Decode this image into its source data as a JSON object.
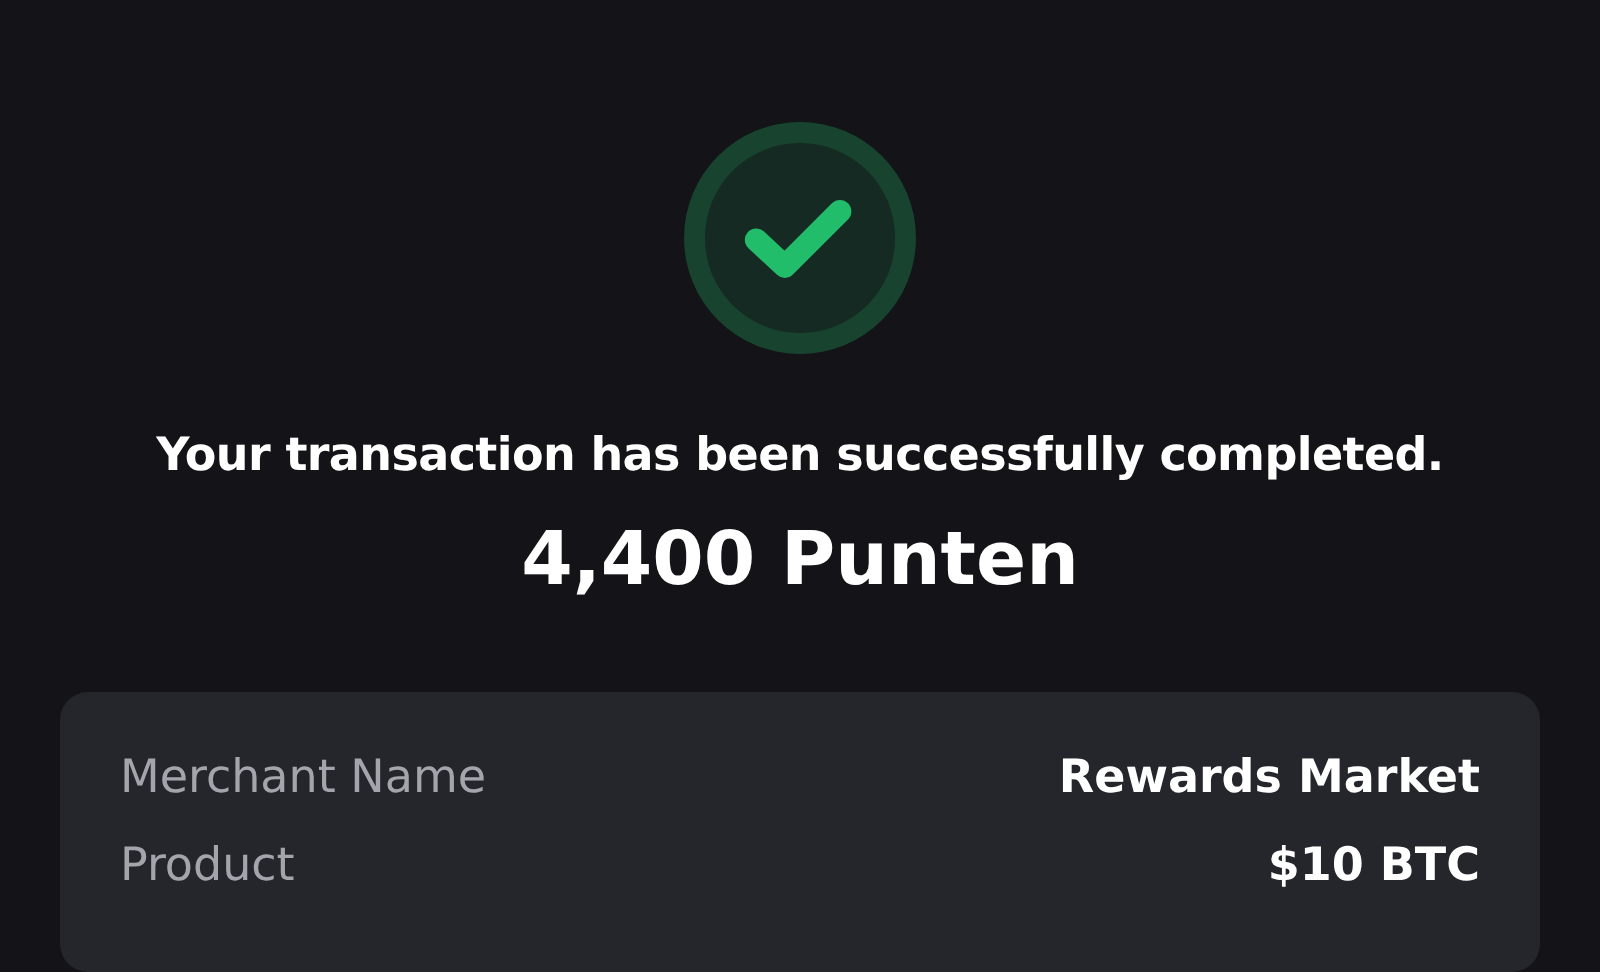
{
  "message": "Your transaction has been successfully completed.",
  "amount": "4,400 Punten",
  "details": [
    {
      "label": "Merchant Name",
      "value": "Rewards Market"
    },
    {
      "label": "Product",
      "value": "$10 BTC"
    }
  ]
}
